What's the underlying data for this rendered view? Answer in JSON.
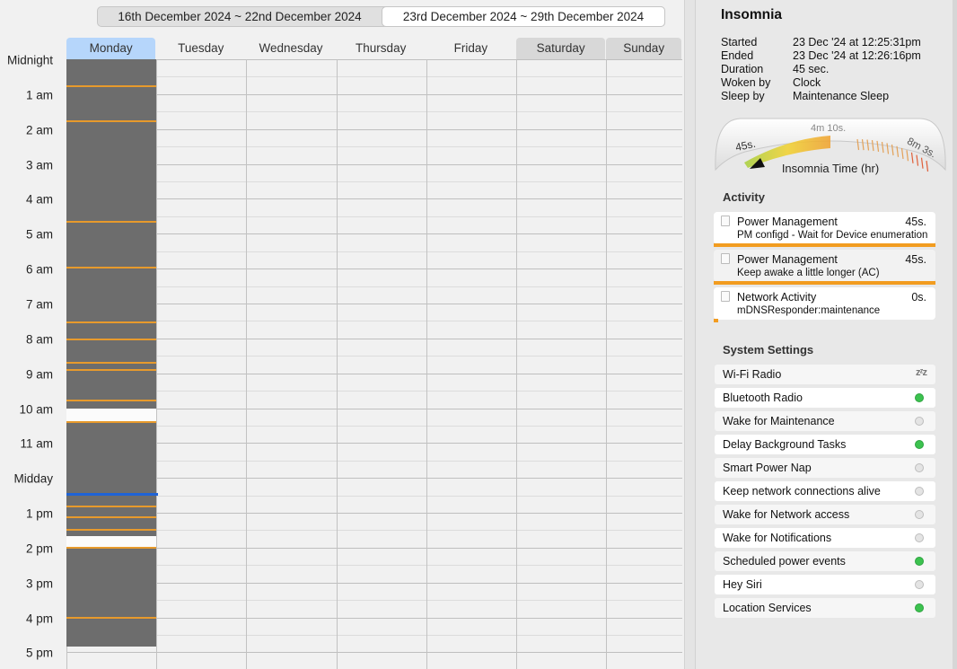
{
  "week_selector": {
    "previous_week": "16th December 2024 ~ 22nd December 2024",
    "current_week": "23rd December 2024 ~ 29th December 2024"
  },
  "days": [
    "Monday",
    "Tuesday",
    "Wednesday",
    "Thursday",
    "Friday",
    "Saturday",
    "Sunday"
  ],
  "selected_day": "Monday",
  "weekend_days": [
    "Saturday",
    "Sunday"
  ],
  "hour_labels": [
    "Midnight",
    "1 am",
    "2 am",
    "3 am",
    "4 am",
    "5 am",
    "6 am",
    "7 am",
    "8 am",
    "9 am",
    "10 am",
    "11 am",
    "Midday",
    "1 pm",
    "2 pm",
    "3 pm",
    "4 pm",
    "5 pm"
  ],
  "monday_timeline": {
    "sleep_periods": [
      {
        "start": "00:00",
        "end": "10:00"
      },
      {
        "start": "10:25",
        "end": "13:40"
      },
      {
        "start": "14:00",
        "end": "16:50"
      }
    ],
    "wake_markers": [
      "00:46",
      "01:47",
      "04:39",
      "05:59",
      "07:32",
      "08:02",
      "08:42",
      "08:55",
      "09:47",
      "10:24",
      "12:49",
      "13:08",
      "13:30",
      "14:00",
      "16:01"
    ],
    "current_time": "12:25"
  },
  "details": {
    "title": "Insomnia",
    "rows": [
      {
        "label": "Started",
        "value": "23 Dec '24 at 12:25:31pm"
      },
      {
        "label": "Ended",
        "value": "23 Dec '24 at 12:26:16pm"
      },
      {
        "label": "Duration",
        "value": "45 sec."
      },
      {
        "label": "Woken by",
        "value": "Clock"
      },
      {
        "label": "Sleep by",
        "value": "Maintenance Sleep"
      }
    ]
  },
  "gauge": {
    "title": "Insomnia Time (hr)",
    "min_label": "45s.",
    "mid_label": "4m 10s.",
    "max_label": "8m 3s.",
    "value_label": "45s."
  },
  "activity": {
    "heading": "Activity",
    "items": [
      {
        "title": "Power Management",
        "duration": "45s.",
        "subtitle": "PM configd - Wait for Device enumeration",
        "fill": 1.0
      },
      {
        "title": "Power Management",
        "duration": "45s.",
        "subtitle": "Keep awake a little longer (AC)",
        "fill": 1.0
      },
      {
        "title": "Network Activity",
        "duration": "0s.",
        "subtitle": "mDNSResponder:maintenance",
        "fill": 0.02
      }
    ]
  },
  "settings": {
    "heading": "System Settings",
    "items": [
      {
        "label": "Wi-Fi Radio",
        "state": "sleep",
        "symbol": "zᶻz"
      },
      {
        "label": "Bluetooth Radio",
        "state": "on"
      },
      {
        "label": "Wake for Maintenance",
        "state": "off"
      },
      {
        "label": "Delay Background Tasks",
        "state": "on"
      },
      {
        "label": "Smart Power Nap",
        "state": "off"
      },
      {
        "label": "Keep network connections alive",
        "state": "off"
      },
      {
        "label": "Wake for Network access",
        "state": "off"
      },
      {
        "label": "Wake for Notifications",
        "state": "off"
      },
      {
        "label": "Scheduled power events",
        "state": "on"
      },
      {
        "label": "Hey Siri",
        "state": "off"
      },
      {
        "label": "Location Services",
        "state": "on"
      }
    ]
  },
  "colors": {
    "sleep": "#6d6d6d",
    "wake_marker": "#e79a2c",
    "current_time": "#1f63d6",
    "selected_day": "#b6d6fb",
    "on": "#3cc24f",
    "activity_bar": "#f29c20"
  }
}
